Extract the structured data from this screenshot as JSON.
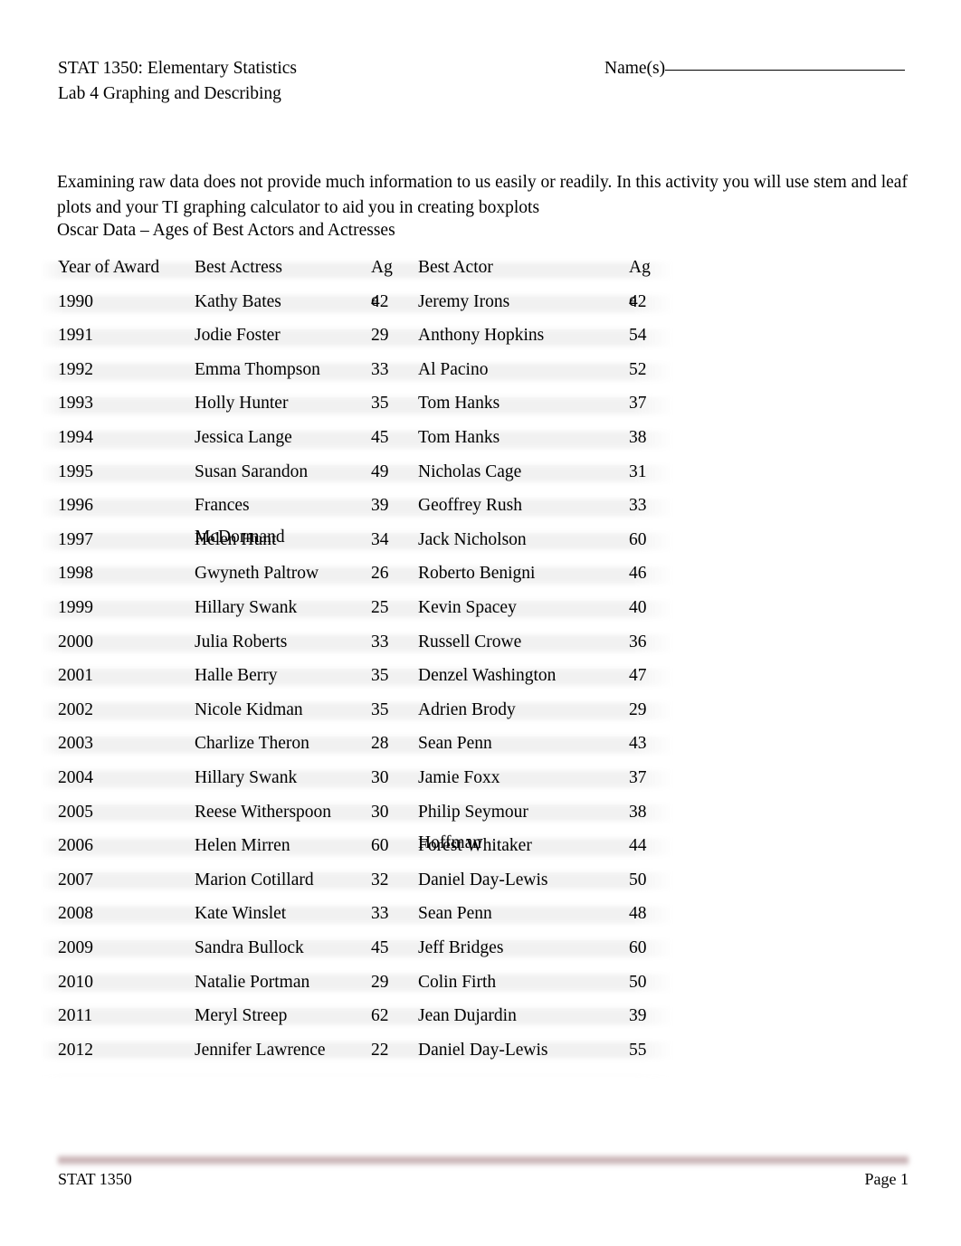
{
  "header": {
    "course_line": "STAT 1350: Elementary Statistics",
    "lab_line": "Lab 4 Graphing and Describing",
    "name_label": "Name(s)"
  },
  "intro": {
    "paragraph": "Examining raw data does not provide much information to us easily or readily. In this activity you will use stem and leaf plots and your TI graphing calculator to aid you in creating boxplots"
  },
  "table": {
    "caption": "Oscar Data – Ages of Best Actors and Actresses",
    "columns": {
      "year": "Year of Award",
      "actress": "Best Actress",
      "actress_age": "Ag",
      "actress_age_overflow": "e",
      "actor": "Best Actor",
      "actor_age": "Ag",
      "actor_age_overflow": "e",
      "age_full": "Age"
    },
    "rows": [
      {
        "year": "1990",
        "actress": "Kathy Bates",
        "actress_age": "42",
        "actor": "Jeremy Irons",
        "actor_age": "42"
      },
      {
        "year": "1991",
        "actress": "Jodie Foster",
        "actress_age": "29",
        "actor": "Anthony Hopkins",
        "actor_age": "54"
      },
      {
        "year": "1992",
        "actress": "Emma Thompson",
        "actress_age": "33",
        "actor": "Al Pacino",
        "actor_age": "52"
      },
      {
        "year": "1993",
        "actress": "Holly Hunter",
        "actress_age": "35",
        "actor": "Tom Hanks",
        "actor_age": "37"
      },
      {
        "year": "1994",
        "actress": "Jessica Lange",
        "actress_age": "45",
        "actor": "Tom Hanks",
        "actor_age": "38"
      },
      {
        "year": "1995",
        "actress": "Susan Sarandon",
        "actress_age": "49",
        "actor": "Nicholas Cage",
        "actor_age": "31"
      },
      {
        "year": "1996",
        "actress": "Frances",
        "actress_overflow": "McDormand",
        "actress_age": "39",
        "actor": "Geoffrey Rush",
        "actor_age": "33"
      },
      {
        "year": "1997",
        "actress": "Helen Hunt",
        "actress_age": "34",
        "actor": "Jack Nicholson",
        "actor_age": "60"
      },
      {
        "year": "1998",
        "actress": "Gwyneth Paltrow",
        "actress_age": "26",
        "actor": "Roberto Benigni",
        "actor_age": "46"
      },
      {
        "year": "1999",
        "actress": "Hillary Swank",
        "actress_age": "25",
        "actor": "Kevin Spacey",
        "actor_age": "40"
      },
      {
        "year": "2000",
        "actress": "Julia Roberts",
        "actress_age": "33",
        "actor": "Russell Crowe",
        "actor_age": "36"
      },
      {
        "year": "2001",
        "actress": "Halle Berry",
        "actress_age": "35",
        "actor": "Denzel Washington",
        "actor_age": "47"
      },
      {
        "year": "2002",
        "actress": "Nicole Kidman",
        "actress_age": "35",
        "actor": "Adrien Brody",
        "actor_age": "29"
      },
      {
        "year": "2003",
        "actress": "Charlize Theron",
        "actress_age": "28",
        "actor": "Sean Penn",
        "actor_age": "43"
      },
      {
        "year": "2004",
        "actress": "Hillary Swank",
        "actress_age": "30",
        "actor": "Jamie Foxx",
        "actor_age": "37"
      },
      {
        "year": "2005",
        "actress": "Reese Witherspoon",
        "actress_age": "30",
        "actor": "Philip Seymour",
        "actor_overflow": "Hoffman",
        "actor_age": "38"
      },
      {
        "year": "2006",
        "actress": "Helen Mirren",
        "actress_age": "60",
        "actor": "Forest Whitaker",
        "actor_age": "44"
      },
      {
        "year": "2007",
        "actress": "Marion Cotillard",
        "actress_age": "32",
        "actor": "Daniel Day-Lewis",
        "actor_age": "50"
      },
      {
        "year": "2008",
        "actress": "Kate Winslet",
        "actress_age": "33",
        "actor": "Sean Penn",
        "actor_age": "48"
      },
      {
        "year": "2009",
        "actress": "Sandra Bullock",
        "actress_age": "45",
        "actor": "Jeff Bridges",
        "actor_age": "60"
      },
      {
        "year": "2010",
        "actress": "Natalie Portman",
        "actress_age": "29",
        "actor": "Colin Firth",
        "actor_age": "50"
      },
      {
        "year": "2011",
        "actress": "Meryl Streep",
        "actress_age": "62",
        "actor": "Jean Dujardin",
        "actor_age": "39"
      },
      {
        "year": "2012",
        "actress": "Jennifer Lawrence",
        "actress_age": "22",
        "actor": "Daniel Day-Lewis",
        "actor_age": "55"
      }
    ]
  },
  "footer": {
    "left": "STAT 1350",
    "right": "Page 1"
  },
  "colors": {
    "footer_rule": "#c2a9ac",
    "band": "#f1f1f1",
    "text": "#000000"
  }
}
